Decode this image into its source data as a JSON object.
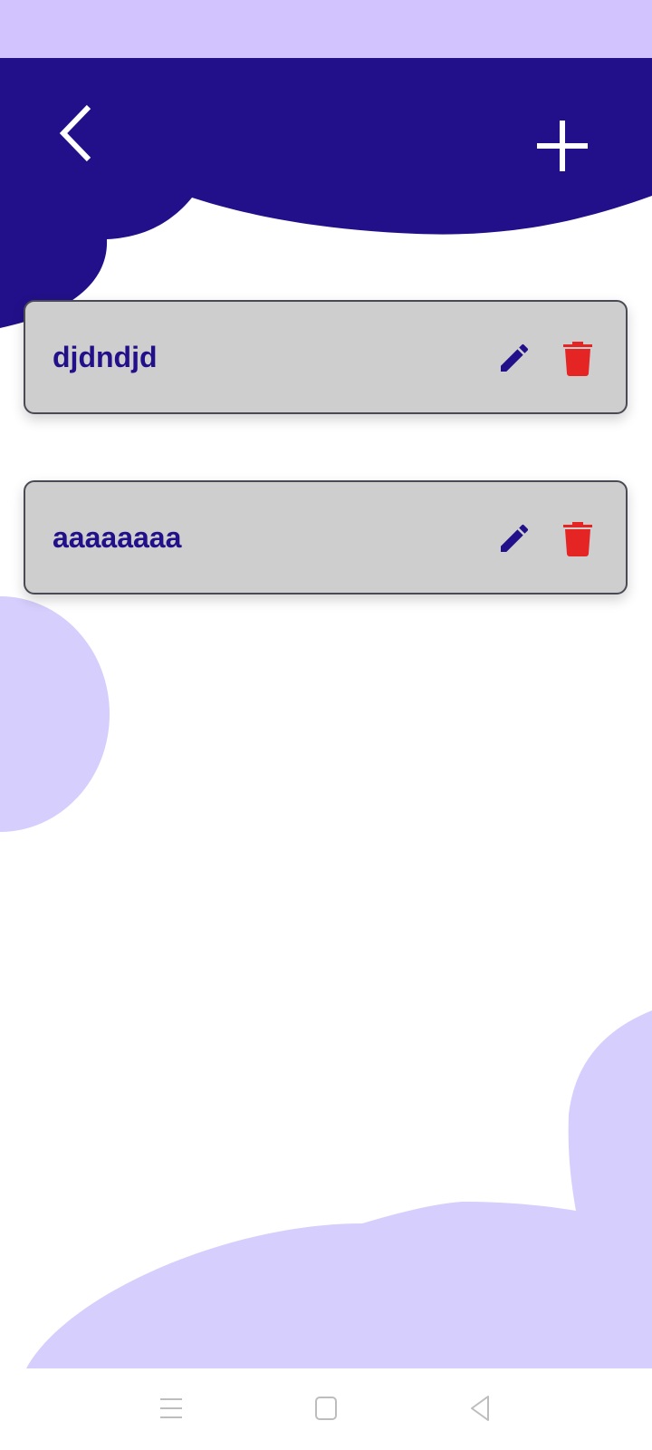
{
  "colors": {
    "header": "#22108a",
    "status_bar": "#d2c2fe",
    "blob": "#d6cefc",
    "card": "#cecece",
    "title": "#22108a",
    "delete": "#e52424",
    "edit": "#22108a"
  },
  "header": {
    "back_icon": "chevron-left-icon",
    "add_icon": "plus-icon"
  },
  "items": [
    {
      "title": "djdndjd"
    },
    {
      "title": "aaaaaaaa"
    }
  ],
  "navbar": {
    "icons": [
      "menu-icon",
      "home-icon",
      "back-icon"
    ]
  }
}
